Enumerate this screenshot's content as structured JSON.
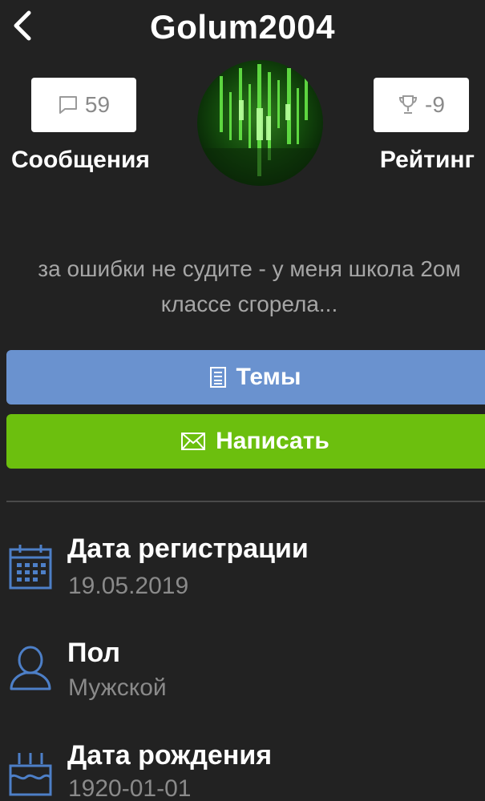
{
  "header": {
    "title": "Golum2004",
    "back_icon": "chevron-left-icon"
  },
  "profile": {
    "messages_count": "59",
    "messages_label": "Сообщения",
    "messages_icon": "speech-bubble-icon",
    "rating_value": "-9",
    "rating_label": "Рейтинг",
    "rating_icon": "trophy-icon",
    "status_text": "за ошибки не судите - у меня школа 2ом классе сгорела..."
  },
  "actions": {
    "topics_label": "Темы",
    "topics_icon": "document-icon",
    "write_label": "Написать",
    "write_icon": "envelope-icon"
  },
  "info": [
    {
      "title": "Дата регистрации",
      "value": "19.05.2019",
      "icon": "calendar-icon"
    },
    {
      "title": "Пол",
      "value": "Мужской",
      "icon": "user-icon"
    },
    {
      "title": "Дата рождения",
      "value": "1920-01-01",
      "icon": "birthday-cake-icon"
    }
  ],
  "colors": {
    "background": "#222222",
    "topics_button": "#6a92cf",
    "write_button": "#6cbf0e",
    "icon_blue": "#4d7fc7",
    "avatar_green": "#2f7a1e"
  }
}
